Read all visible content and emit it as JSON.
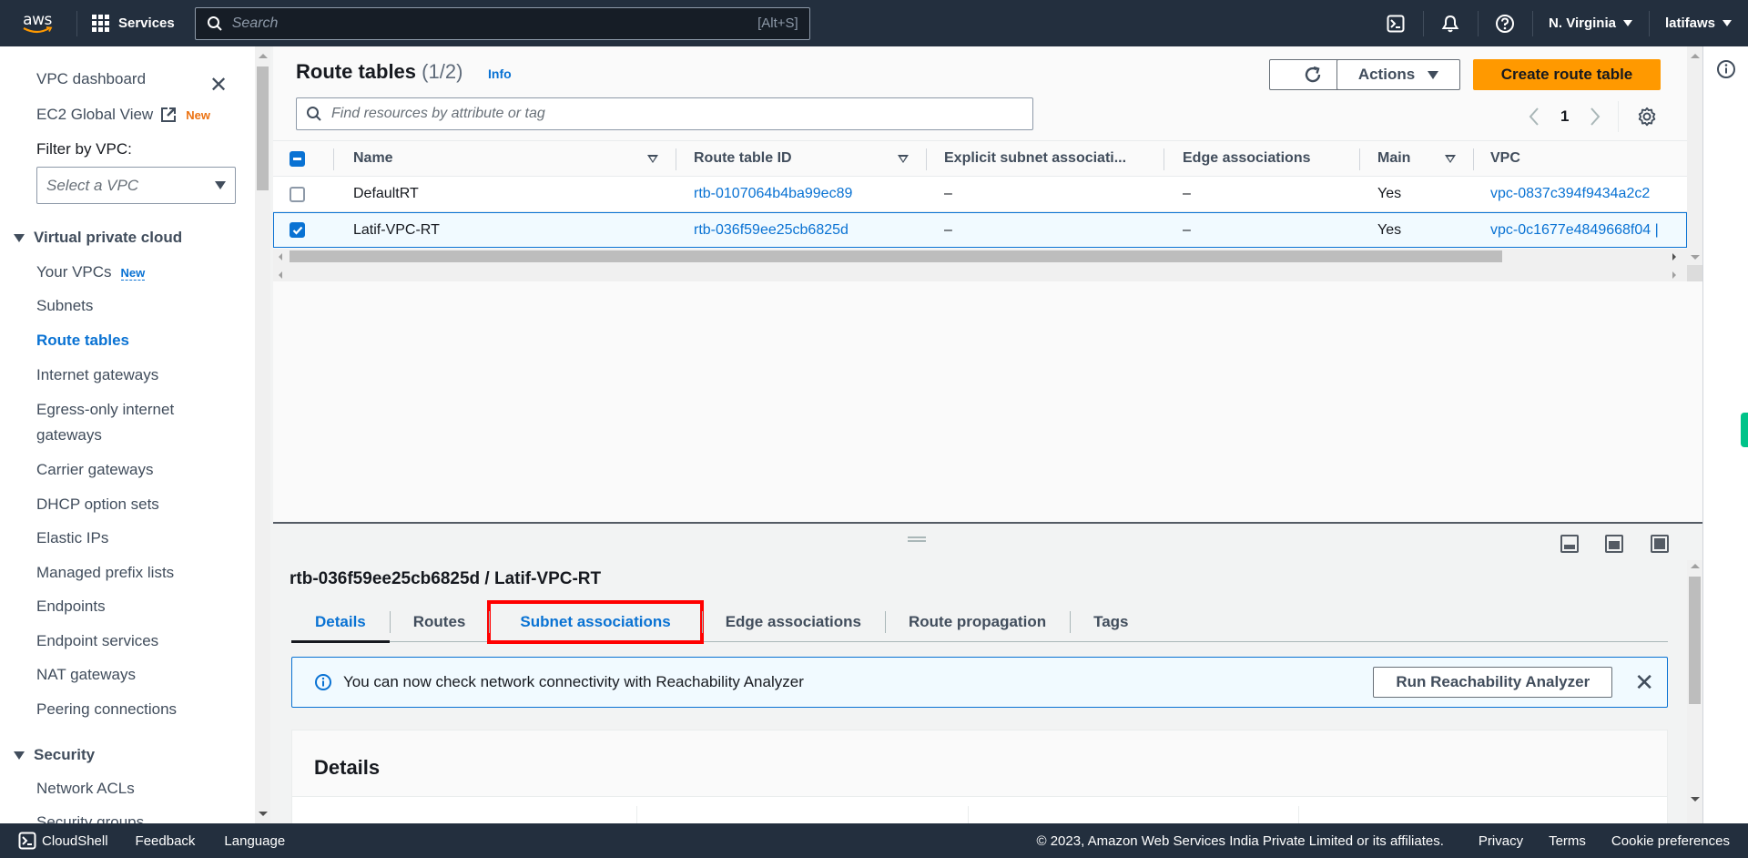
{
  "topnav": {
    "logo": "aws",
    "services_label": "Services",
    "search_placeholder": "Search",
    "search_shortcut": "[Alt+S]",
    "icons": [
      "cloudshell-icon",
      "bell-icon",
      "help-icon"
    ],
    "region": "N. Virginia",
    "account": "latifaws"
  },
  "sidebar": {
    "dashboard": "VPC dashboard",
    "global_view": "EC2 Global View",
    "global_view_badge": "New",
    "filter_label": "Filter by VPC:",
    "filter_placeholder": "Select a VPC",
    "section_vpc": "Virtual private cloud",
    "your_vpcs": "Your VPCs",
    "your_vpcs_badge": "New",
    "items": [
      {
        "label": "Subnets",
        "active": false
      },
      {
        "label": "Route tables",
        "active": true
      },
      {
        "label": "Internet gateways",
        "active": false
      },
      {
        "label": "Egress-only internet",
        "active": false
      },
      {
        "label": "gateways",
        "active": false
      },
      {
        "label": "Carrier gateways",
        "active": false
      },
      {
        "label": "DHCP option sets",
        "active": false
      },
      {
        "label": "Elastic IPs",
        "active": false
      },
      {
        "label": "Managed prefix lists",
        "active": false
      },
      {
        "label": "Endpoints",
        "active": false
      },
      {
        "label": "Endpoint services",
        "active": false
      },
      {
        "label": "NAT gateways",
        "active": false
      },
      {
        "label": "Peering connections",
        "active": false
      }
    ],
    "section_security": "Security",
    "security_items": [
      "Network ACLs",
      "Security groups"
    ]
  },
  "main": {
    "title": "Route tables",
    "count": "(1/2)",
    "info": "Info",
    "filter_placeholder": "Find resources by attribute or tag",
    "actions_label": "Actions",
    "create_label": "Create route table",
    "page": "1",
    "columns": [
      "Name",
      "Route table ID",
      "Explicit subnet associati...",
      "Edge associations",
      "Main",
      "VPC"
    ],
    "rows": [
      {
        "selected": false,
        "name": "DefaultRT",
        "id": "rtb-0107064b4ba99ec89",
        "explicit": "–",
        "edge": "–",
        "main": "Yes",
        "vpc": "vpc-0837c394f9434a2c2"
      },
      {
        "selected": true,
        "name": "Latif-VPC-RT",
        "id": "rtb-036f59ee25cb6825d",
        "explicit": "–",
        "edge": "–",
        "main": "Yes",
        "vpc": "vpc-0c1677e4849668f04 |"
      }
    ]
  },
  "split": {
    "title": "rtb-036f59ee25cb6825d / Latif-VPC-RT",
    "tabs": [
      "Details",
      "Routes",
      "Subnet associations",
      "Edge associations",
      "Route propagation",
      "Tags"
    ],
    "active_tab": "Details",
    "highlighted_tab": "Subnet associations",
    "alert_text": "You can now check network connectivity with Reachability Analyzer",
    "alert_button": "Run Reachability Analyzer",
    "details_heading": "Details"
  },
  "footer": {
    "cloudshell": "CloudShell",
    "feedback": "Feedback",
    "language": "Language",
    "copyright": "© 2023, Amazon Web Services India Private Limited or its affiliates.",
    "privacy": "Privacy",
    "terms": "Terms",
    "cookies": "Cookie preferences"
  },
  "colors": {
    "nav_bg": "#232f3e",
    "link_blue": "#0972d3",
    "primary_orange": "#ff9900",
    "badge_orange": "#ec7211",
    "highlight_red": "#ff0000"
  }
}
